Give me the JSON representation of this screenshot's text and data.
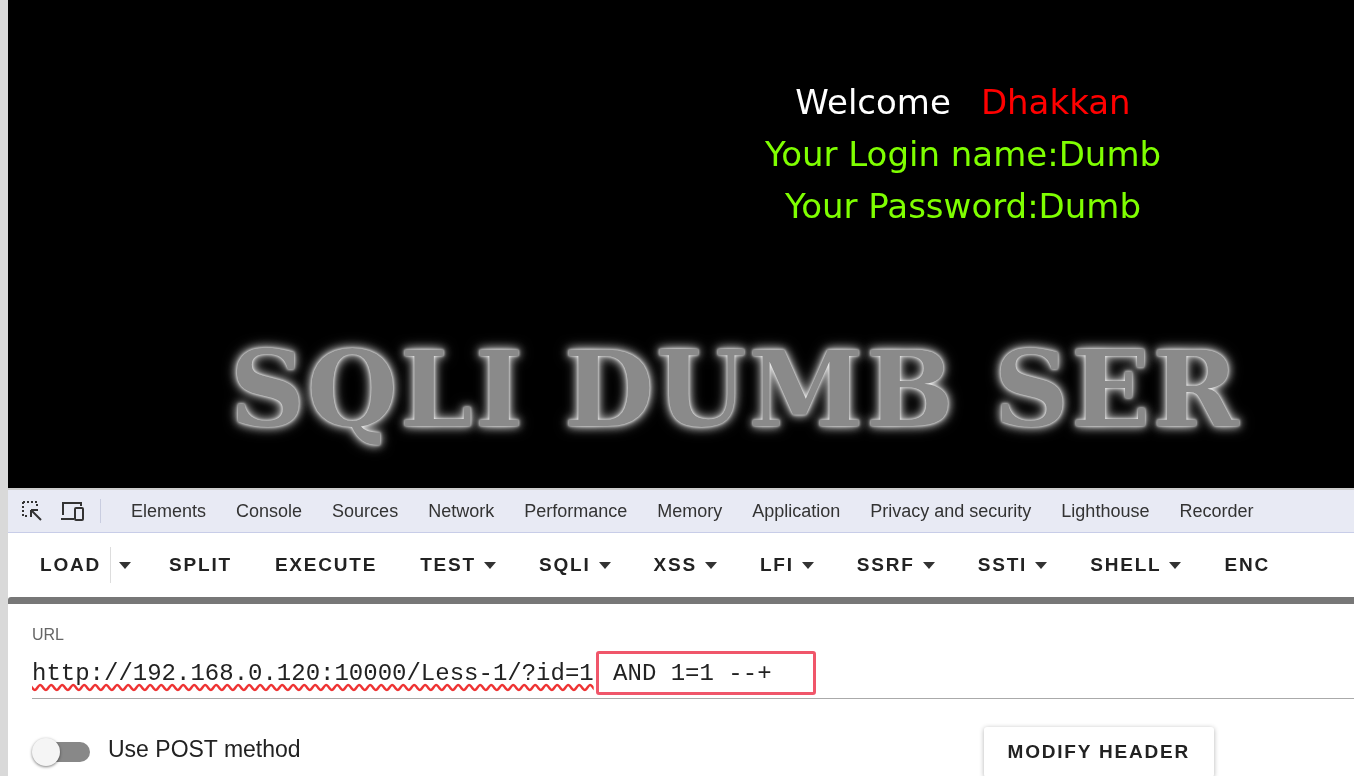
{
  "page": {
    "welcome_label": "Welcome",
    "welcome_name": "Dhakkan",
    "login_line": "Your Login name:Dumb",
    "password_line": "Your Password:Dumb",
    "banner": "SQLI DUMB SER"
  },
  "devtools_tabs": [
    {
      "label": "Elements",
      "selected": false
    },
    {
      "label": "Console",
      "selected": false
    },
    {
      "label": "Sources",
      "selected": false
    },
    {
      "label": "Network",
      "selected": false
    },
    {
      "label": "Performance",
      "selected": false
    },
    {
      "label": "Memory",
      "selected": false
    },
    {
      "label": "Application",
      "selected": false
    },
    {
      "label": "Privacy and security",
      "selected": false
    },
    {
      "label": "Lighthouse",
      "selected": false
    },
    {
      "label": "Recorder",
      "selected": false
    }
  ],
  "hackbar_toolbar": [
    {
      "label": "LOAD",
      "has_menu": false,
      "split_menu": true
    },
    {
      "label": "SPLIT",
      "has_menu": false,
      "split_menu": false
    },
    {
      "label": "EXECUTE",
      "has_menu": false,
      "split_menu": false
    },
    {
      "label": "TEST",
      "has_menu": true,
      "split_menu": false
    },
    {
      "label": "SQLI",
      "has_menu": true,
      "split_menu": false
    },
    {
      "label": "XSS",
      "has_menu": true,
      "split_menu": false
    },
    {
      "label": "LFI",
      "has_menu": true,
      "split_menu": false
    },
    {
      "label": "SSRF",
      "has_menu": true,
      "split_menu": false
    },
    {
      "label": "SSTI",
      "has_menu": true,
      "split_menu": false
    },
    {
      "label": "SHELL",
      "has_menu": true,
      "split_menu": false
    },
    {
      "label": "ENC",
      "has_menu": false,
      "split_menu": false
    }
  ],
  "url_field": {
    "label": "URL",
    "value": "http://192.168.0.120:10000/Less-1/?id=1",
    "highlighted_value": " AND 1=1 --+"
  },
  "post_toggle": {
    "label": "Use POST method",
    "on": false
  },
  "modify_header_button": "MODIFY HEADER"
}
